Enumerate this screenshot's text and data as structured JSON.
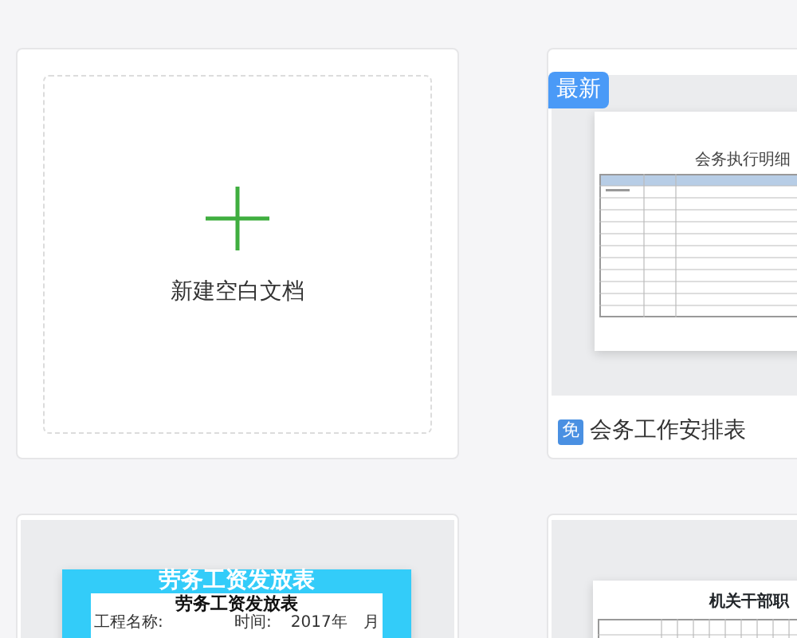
{
  "blank_card": {
    "label": "新建空白文档"
  },
  "templates": [
    {
      "badge": "最新",
      "free_tag": "免",
      "title": "会务工作安排表",
      "preview": {
        "kind": "meeting",
        "heading": "会务执行明细"
      }
    },
    {
      "preview": {
        "kind": "payroll",
        "banner": "劳务工资发放表",
        "heading": "劳务工资发放表",
        "fields": [
          "工程名称:",
          "时间:",
          "2017年",
          "月"
        ]
      }
    },
    {
      "preview": {
        "kind": "staff",
        "heading": "机关干部职"
      }
    }
  ]
}
